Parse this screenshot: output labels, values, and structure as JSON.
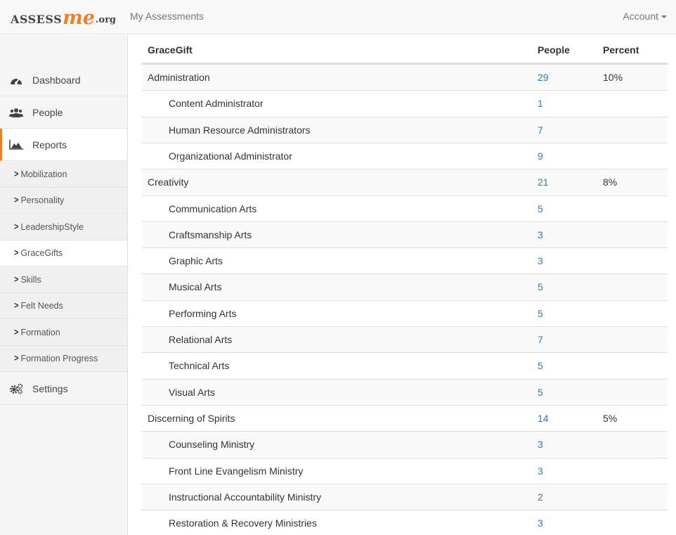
{
  "brand": {
    "part1": "ASSESS",
    "part2": "me",
    "part3": ".org"
  },
  "nav": {
    "my_assessments": "My Assessments",
    "account": "Account"
  },
  "sidebar": {
    "main_items": [
      {
        "label": "Dashboard",
        "icon": "dashboard-icon"
      },
      {
        "label": "People",
        "icon": "users-icon"
      },
      {
        "label": "Reports",
        "icon": "area-chart-icon"
      }
    ],
    "report_items": [
      "Mobilization",
      "Personality",
      "LeadershipStyle",
      "GraceGifts",
      "Skills",
      "Felt Needs",
      "Formation",
      "Formation Progress"
    ],
    "settings": {
      "label": "Settings",
      "icon": "cogs-icon"
    }
  },
  "table": {
    "headers": {
      "name": "GraceGift",
      "people": "People",
      "percent": "Percent"
    },
    "rows": [
      {
        "name": "Administration",
        "people": "29",
        "percent": "10%",
        "level": "parent"
      },
      {
        "name": "Content Administrator",
        "people": "1",
        "percent": "",
        "level": "child"
      },
      {
        "name": "Human Resource Administrators",
        "people": "7",
        "percent": "",
        "level": "child"
      },
      {
        "name": "Organizational Administrator",
        "people": "9",
        "percent": "",
        "level": "child"
      },
      {
        "name": "Creativity",
        "people": "21",
        "percent": "8%",
        "level": "parent"
      },
      {
        "name": "Communication Arts",
        "people": "5",
        "percent": "",
        "level": "child"
      },
      {
        "name": "Craftsmanship Arts",
        "people": "3",
        "percent": "",
        "level": "child"
      },
      {
        "name": "Graphic Arts",
        "people": "3",
        "percent": "",
        "level": "child"
      },
      {
        "name": "Musical Arts",
        "people": "5",
        "percent": "",
        "level": "child"
      },
      {
        "name": "Performing Arts",
        "people": "5",
        "percent": "",
        "level": "child"
      },
      {
        "name": "Relational Arts",
        "people": "7",
        "percent": "",
        "level": "child"
      },
      {
        "name": "Technical Arts",
        "people": "5",
        "percent": "",
        "level": "child"
      },
      {
        "name": "Visual Arts",
        "people": "5",
        "percent": "",
        "level": "child"
      },
      {
        "name": "Discerning of Spirits",
        "people": "14",
        "percent": "5%",
        "level": "parent"
      },
      {
        "name": "Counseling Ministry",
        "people": "3",
        "percent": "",
        "level": "child"
      },
      {
        "name": "Front Line Evangelism Ministry",
        "people": "3",
        "percent": "",
        "level": "child"
      },
      {
        "name": "Instructional Accountability Ministry",
        "people": "2",
        "percent": "",
        "level": "child"
      },
      {
        "name": "Restoration & Recovery Ministries",
        "people": "3",
        "percent": "",
        "level": "child"
      }
    ]
  }
}
